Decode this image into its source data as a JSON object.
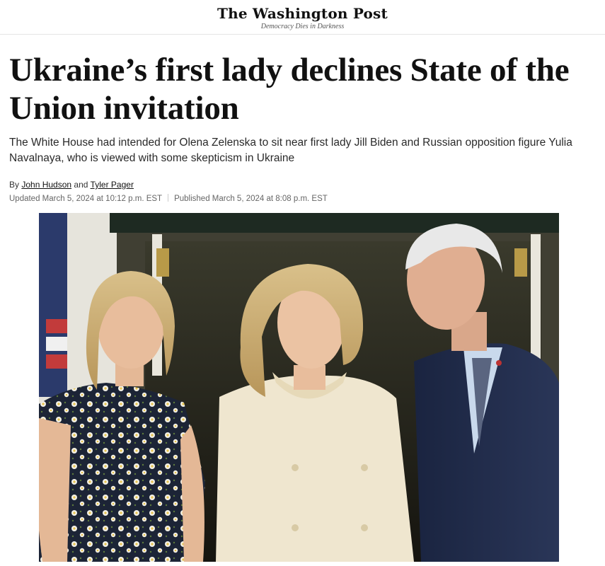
{
  "masthead": {
    "logo": "The Washington Post",
    "tagline": "Democracy Dies in Darkness"
  },
  "article": {
    "headline": "Ukraine’s first lady declines State of the Union invitation",
    "dek": "The White House had intended for Olena Zelenska to sit near first lady Jill Biden and Russian opposition figure Yulia Navalnaya, who is viewed with some skepticism in Ukraine",
    "byline": {
      "prefix": "By",
      "author1": "John Hudson",
      "conjunction": "and",
      "author2": "Tyler Pager"
    },
    "updated": "Updated March 5, 2024 at 10:12 p.m. EST",
    "published": "Published March 5, 2024 at 8:08 p.m. EST"
  },
  "photo": {
    "icon": "lead-photo-three-people-at-white-house"
  },
  "colors": {
    "text": "#111111",
    "meta": "#666666",
    "suit": "#1f2a44",
    "dress_cream": "#efe6cf",
    "floral_dress": "#1c2436"
  }
}
